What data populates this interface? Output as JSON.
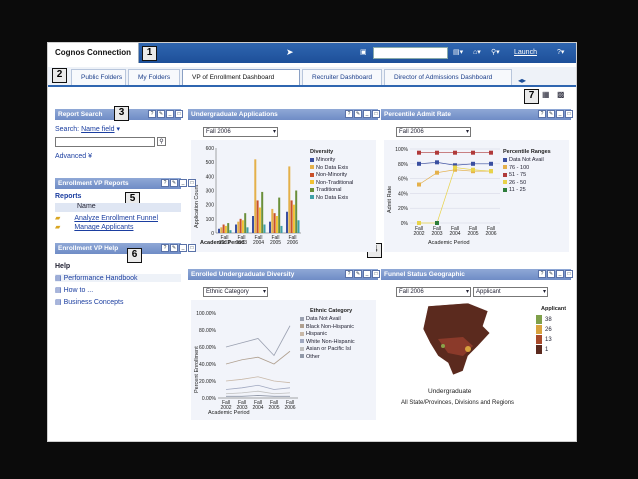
{
  "app": {
    "title": "Cognos Connection",
    "launch": "Launch"
  },
  "callouts": [
    "1",
    "2",
    "3",
    "4",
    "5",
    "6",
    "7"
  ],
  "tabs": [
    "Public Folders",
    "My Folders",
    "VP of Enrollment Dashboard",
    "Recruiter Dashboard",
    "Director of Admissions Dashboard"
  ],
  "report_search": {
    "title": "Report Search",
    "search_label": "Search:",
    "search_field": "Name field",
    "advanced": "Advanced"
  },
  "enrollment_reports": {
    "title": "Enrollment VP Reports",
    "heading": "Reports",
    "col": "Name",
    "items": [
      "Analyze Enrollment Funnel",
      "Manage Applicants"
    ]
  },
  "help": {
    "title": "Enrollment VP Help",
    "heading": "Help",
    "items": [
      "Performance Handbook",
      "How to ...",
      "Business Concepts"
    ]
  },
  "undergrad_apps": {
    "title": "Undergraduate Applications",
    "select": "Fall 2006",
    "legend_title": "Diversity",
    "legend": [
      "Minority",
      "No Data Exis",
      "Non-Minority",
      "Non-Traditional",
      "Traditional",
      "No Data Exis"
    ],
    "ylabel": "Application Count",
    "xlabel": "Academic Period"
  },
  "percentile": {
    "title": "Percentile Admit Rate",
    "select": "Fall 2006",
    "legend_title": "Percentile Ranges",
    "legend": [
      "Data Not Avail",
      "76 - 100",
      "51 - 75",
      "26 - 50",
      "11 - 25"
    ],
    "ylabel": "Admit Rate",
    "xlabel": "Academic Period"
  },
  "diversity": {
    "title": "Enrolled Undergraduate Diversity",
    "select": "Ethnic Category",
    "legend_title": "Ethnic Category",
    "legend": [
      "Data Not Avail",
      "Black Non-Hispanic",
      "Hispanic",
      "White Non-Hispanic",
      "Asian or Pacific Isl",
      "Other"
    ],
    "ylabel": "Percent Enrollment",
    "xlabel": "Academic Period"
  },
  "funnel": {
    "title": "Funnel Status Geographic",
    "select1": "Fall 2006",
    "select2": "Applicant",
    "legend_title": "Applicant",
    "legend": [
      "38",
      "26",
      "13",
      "1"
    ],
    "map_title": "Undergraduate",
    "map_sub": "All State/Provinces, Divisions and Regions"
  },
  "colors": {
    "minority": "#3a4fa0",
    "nodata1": "#e4b04a",
    "nonminority": "#c9502a",
    "nontrad": "#f1c232",
    "trad": "#6a8f3a",
    "nodata2": "#3fa0a8"
  },
  "chart_data": [
    {
      "type": "bar",
      "categories": [
        "Fall 2002",
        "Fall 2003",
        "Fall 2004",
        "Fall 2005",
        "Fall 2006"
      ],
      "ylim": [
        0,
        600
      ],
      "yticks": [
        "600",
        "500",
        "400",
        "300",
        "200",
        "100",
        "0"
      ],
      "series": [
        {
          "name": "Minority",
          "values": [
            30,
            60,
            120,
            80,
            150
          ]
        },
        {
          "name": "No Data Exis",
          "values": [
            40,
            80,
            520,
            170,
            470
          ]
        },
        {
          "name": "Non-Minority",
          "values": [
            60,
            100,
            230,
            140,
            230
          ]
        },
        {
          "name": "Non-Traditional",
          "values": [
            50,
            90,
            180,
            120,
            200
          ]
        },
        {
          "name": "Traditional",
          "values": [
            70,
            140,
            290,
            250,
            300
          ]
        },
        {
          "name": "No Data Exis",
          "values": [
            20,
            40,
            60,
            50,
            90
          ]
        }
      ]
    },
    {
      "type": "line",
      "categories": [
        "Fall 2002",
        "Fall 2003",
        "Fall 2004",
        "Fall 2005",
        "Fall 2006"
      ],
      "ylim": [
        0,
        100
      ],
      "yticks": [
        "100%",
        "80%",
        "60%",
        "40%",
        "20%",
        "0%"
      ],
      "series": [
        {
          "name": "Data Not Avail",
          "values": [
            80,
            82,
            78,
            80,
            80
          ]
        },
        {
          "name": "76 - 100",
          "values": [
            52,
            68,
            72,
            70,
            70
          ]
        },
        {
          "name": "51 - 75",
          "values": [
            95,
            95,
            95,
            95,
            95
          ]
        },
        {
          "name": "26 - 50",
          "values": [
            0,
            0,
            75,
            72,
            70
          ]
        },
        {
          "name": "11 - 25",
          "values": [
            null,
            0,
            null,
            null,
            null
          ]
        }
      ]
    },
    {
      "type": "line",
      "categories": [
        "Fall 2002",
        "Fall 2003",
        "Fall 2004",
        "Fall 2005",
        "Fall 2006"
      ],
      "ylim": [
        0,
        100
      ],
      "yticks": [
        "100.00%",
        "80.00%",
        "60.00%",
        "40.00%",
        "20.00%",
        "0.00%"
      ],
      "series": [
        {
          "name": "Data Not Avail",
          "values": [
            60,
            65,
            70,
            50,
            85
          ]
        },
        {
          "name": "Black Non-Hispanic",
          "values": [
            40,
            45,
            48,
            40,
            55
          ]
        },
        {
          "name": "Hispanic",
          "values": [
            20,
            22,
            25,
            20,
            18
          ]
        },
        {
          "name": "White Non-Hispanic",
          "values": [
            10,
            12,
            15,
            10,
            12
          ]
        },
        {
          "name": "Asian or Pacific Isl",
          "values": [
            5,
            6,
            8,
            5,
            6
          ]
        },
        {
          "name": "Other",
          "values": [
            2,
            2,
            3,
            2,
            2
          ]
        }
      ]
    }
  ]
}
